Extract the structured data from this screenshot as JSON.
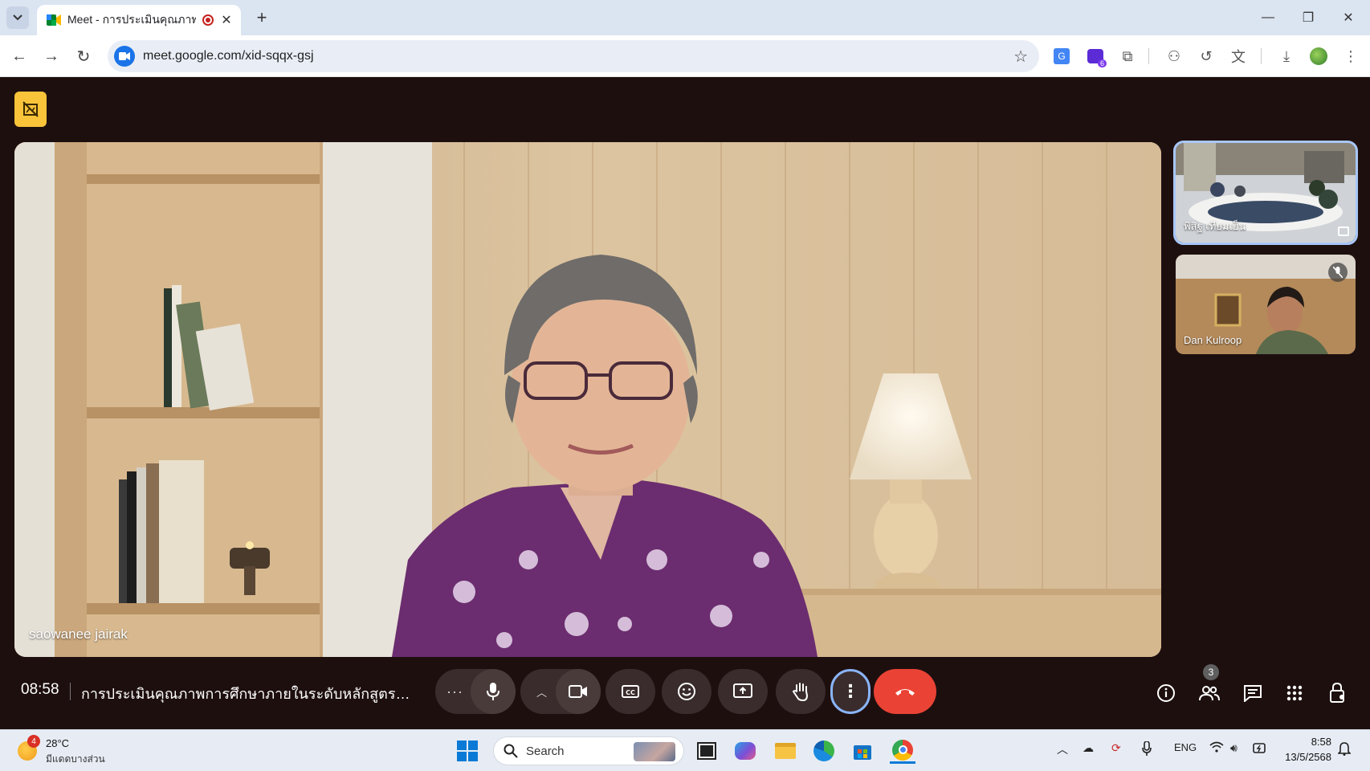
{
  "browser": {
    "tab_title": "Meet - การประเมินคุณภาพการ",
    "new_tab": "+",
    "url": "meet.google.com/xid-sqqx-gsj",
    "extension_badge": "6"
  },
  "meet": {
    "main_speaker": "saowanee jairak",
    "participants": [
      {
        "name": "พิสิฐ เทียมเย็น"
      },
      {
        "name": "Dan Kulroop"
      }
    ],
    "time": "08:58",
    "meeting_title": "การประเมินคุณภาพการศึกษาภายในระดับหลักสูตรบัญชีบั...",
    "participant_count": "3",
    "colors": {
      "end_call": "#ea4335",
      "active_ring": "#8ab4f8",
      "control_bg": "#3a2c2c"
    }
  },
  "taskbar": {
    "weather_badge": "4",
    "weather_temp": "28°C",
    "weather_desc": "มีแดดบางส่วน",
    "search_placeholder": "Search",
    "language": "ENG",
    "time": "8:58",
    "date": "13/5/2568"
  }
}
